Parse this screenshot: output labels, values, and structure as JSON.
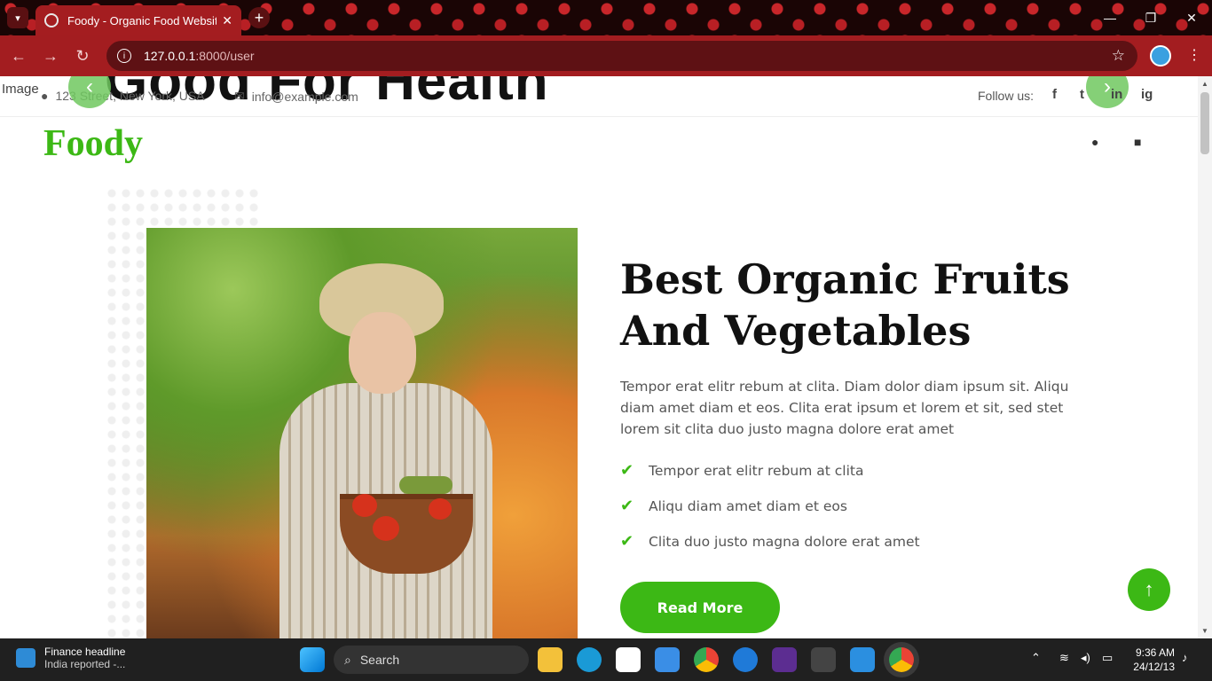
{
  "browser": {
    "tab_title": "Foody - Organic Food Website",
    "url_host": "127.0.0.1",
    "url_path": ":8000/user"
  },
  "topbar": {
    "broken_image_alt": "Image",
    "banner_partial_title": "Good For Health",
    "address": "123 Street, New York, USA",
    "email": "info@example.com",
    "follow_label": "Follow us:",
    "social": [
      "f",
      "t",
      "in",
      "ig"
    ]
  },
  "header": {
    "brand": "Foody"
  },
  "about": {
    "heading": "Best Organic Fruits And Vegetables",
    "paragraph": "Tempor erat elitr rebum at clita. Diam dolor diam ipsum sit. Aliqu diam amet diam et eos. Clita erat ipsum et lorem et sit, sed stet lorem sit clita duo justo magna dolore erat amet",
    "features": [
      "Tempor erat elitr rebum at clita",
      "Aliqu diam amet diam et eos",
      "Clita duo justo magna dolore erat amet"
    ],
    "button": "Read More"
  },
  "taskbar": {
    "news_title": "Finance headline",
    "news_sub": "India reported -...",
    "search_label": "Search",
    "time": "9:36 AM",
    "date": "24/12/13"
  },
  "colors": {
    "brand_green": "#3cb815",
    "browser_red": "#a31d20"
  }
}
